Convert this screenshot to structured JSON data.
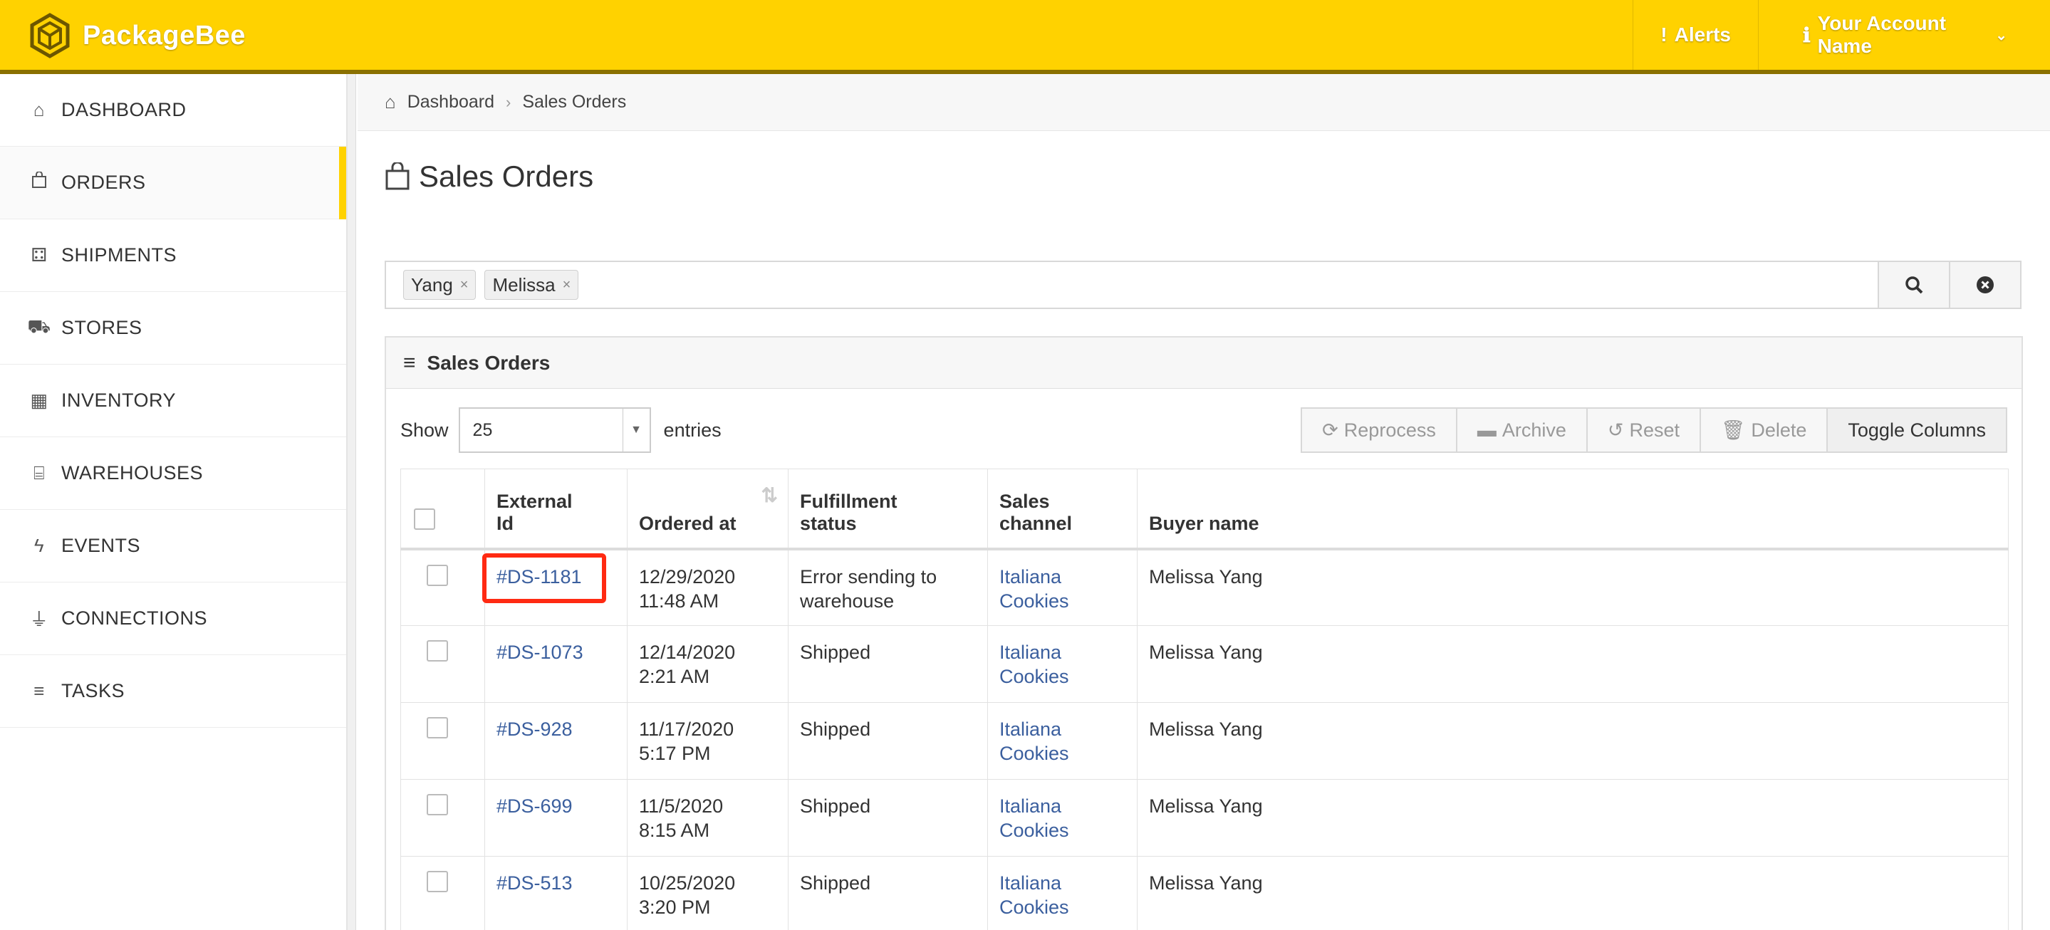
{
  "brand": {
    "name": "PackageBee"
  },
  "topnav": {
    "alerts_label": "Alerts",
    "account_label": "Your Account Name"
  },
  "sidebar": {
    "items": [
      {
        "label": "DASHBOARD",
        "icon": "home-icon"
      },
      {
        "label": "ORDERS",
        "icon": "shopping-bag-icon",
        "active": true
      },
      {
        "label": "SHIPMENTS",
        "icon": "package-icon"
      },
      {
        "label": "STORES",
        "icon": "cart-icon"
      },
      {
        "label": "INVENTORY",
        "icon": "inventory-icon"
      },
      {
        "label": "WAREHOUSES",
        "icon": "warehouse-icon"
      },
      {
        "label": "EVENTS",
        "icon": "bolt-icon"
      },
      {
        "label": "CONNECTIONS",
        "icon": "plug-icon"
      },
      {
        "label": "TASKS",
        "icon": "list-icon"
      }
    ]
  },
  "breadcrumb": {
    "home": "Dashboard",
    "current": "Sales Orders"
  },
  "page": {
    "title": "Sales Orders"
  },
  "search": {
    "tags": [
      "Yang",
      "Melissa"
    ]
  },
  "panel": {
    "title": "Sales Orders"
  },
  "controls": {
    "show_label": "Show",
    "page_size": "25",
    "entries_label": "entries"
  },
  "toolbar": {
    "reprocess": "Reprocess",
    "archive": "Archive",
    "reset": "Reset",
    "delete": "Delete",
    "toggle_columns": "Toggle Columns"
  },
  "table": {
    "headers": {
      "external_id_1": "External",
      "external_id_2": "Id",
      "ordered_at": "Ordered at",
      "fulfillment_1": "Fulfillment",
      "fulfillment_2": "status",
      "channel_1": "Sales",
      "channel_2": "channel",
      "buyer": "Buyer name"
    },
    "rows": [
      {
        "id": "#DS-1181",
        "date": "12/29/2020",
        "time": "11:48 AM",
        "status_1": "Error sending to",
        "status_2": "warehouse",
        "channel_1": "Italiana",
        "channel_2": "Cookies",
        "buyer": "Melissa Yang"
      },
      {
        "id": "#DS-1073",
        "date": "12/14/2020",
        "time": "2:21 AM",
        "status_1": "Shipped",
        "status_2": "",
        "channel_1": "Italiana",
        "channel_2": "Cookies",
        "buyer": "Melissa Yang"
      },
      {
        "id": "#DS-928",
        "date": "11/17/2020",
        "time": "5:17 PM",
        "status_1": "Shipped",
        "status_2": "",
        "channel_1": "Italiana",
        "channel_2": "Cookies",
        "buyer": "Melissa Yang"
      },
      {
        "id": "#DS-699",
        "date": "11/5/2020",
        "time": "8:15 AM",
        "status_1": "Shipped",
        "status_2": "",
        "channel_1": "Italiana",
        "channel_2": "Cookies",
        "buyer": "Melissa Yang"
      },
      {
        "id": "#DS-513",
        "date": "10/25/2020",
        "time": "3:20 PM",
        "status_1": "Shipped",
        "status_2": "",
        "channel_1": "Italiana",
        "channel_2": "Cookies",
        "buyer": "Melissa Yang"
      }
    ]
  },
  "colors": {
    "brand_yellow": "#FFD200",
    "link_blue": "#3b5f9e",
    "highlight_red": "#ff2a12"
  }
}
